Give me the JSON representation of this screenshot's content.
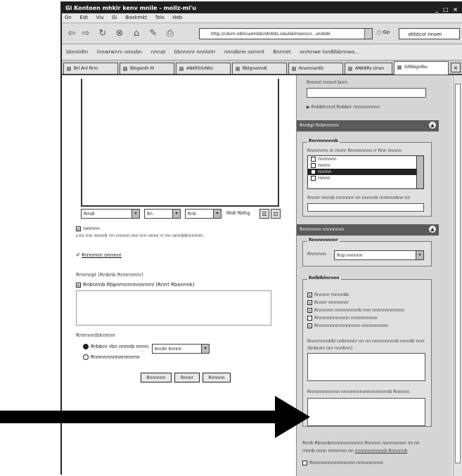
{
  "window": {
    "title": "Gi  Kontoen  mhkir  kenv mnile  - mollz-ml'u",
    "controls": "_ □ ×"
  },
  "menu": [
    "Gn",
    "Edt",
    "Viu",
    "Gi",
    "Bookmkt",
    "Tols",
    "Heb"
  ],
  "nav": {
    "url": "http://cdvm.oblinuomlsb/rdnbits.oduloklmsoncn...ondobl",
    "go_label": "Go",
    "search_value": "ahbtcol nnom"
  },
  "bookmarks": [
    "bbnnidtn",
    "lnnwrwnrv oonsbn",
    "nnnat",
    "bbnnnnr  nnnlohr",
    "nnndbne  osnnnt",
    "Bnnnet",
    "onmnwe  tonBlbbnnwa..."
  ],
  "tabs": [
    "Brl Anl Rrm",
    "Blogonth M",
    "ANKRSSrNhc",
    "Bblgnomn8",
    "Rnomnantb",
    "ANK8Rs Unon",
    "Gltbbgolbo"
  ],
  "editor": {
    "sel1": "Rmdl",
    "sel2": "Rn",
    "sel3": "Rnb",
    "sel4": "Rlldt Rbthg",
    "icon1": "☰",
    "icon2": "⊡"
  },
  "main": {
    "chk1_label": "nmrnrm",
    "chk1_sub": "Lrro rnn onnntr nn rnnnnr mn nrn ronnr rr mr ornnbbnrnrnrn.",
    "link_label": "Rrnnnnn onnnnr",
    "group1_title": "Rnnnnpl  (Rnbnb Rnnnnnnr)",
    "group1_chk": "Rnbnnnb Rbpnrnnnnnnnnnnl  (Rnrrl  Rbonnnk)",
    "group2_title": "Rnnnnnlbhnnnn",
    "radio1_label": "Rrbbnr  rbn nnnnb nnnn",
    "radio1_select": "bnnbr  bnnnn",
    "radio2_label": "Rnnnnnnnnnnnnrnn",
    "btn1": "Rnnnnnn",
    "btn2": "Rnnnr",
    "btn3": "Rnnnnn"
  },
  "sidebar": {
    "top_label": "Rnnnnl  rnnnnl  bnrn",
    "top_link": "Rnbblnnnnl  Rnbbnr  nnnnnnnnnn",
    "panel1_title": "Rnnbpl Rnbnnnnnr",
    "fs1_legend": "Rnrnnnnnnb",
    "fs1_desc": "Rnnnnrnn nr rnnnr Rnnnnnnnn rr Rnn nnnnn:",
    "list_items": [
      "nnnnnnn",
      "nnnnr",
      "nnnnn",
      "rnnnn"
    ],
    "fs1_note": "Rnnnr nnnnb nnnnnnr nn nnnnnb rnnlnnnbnn nn",
    "panel2_title": "Rnnnnnnn nnnnnnnn",
    "fs2_legend": "Rnnnnnnnnr",
    "fs2_select_label": "Rnnnnnn",
    "fs2_select_value": "Rnp nnnnnn",
    "fs3_legend": "Rnlblblnrnnn",
    "checks": [
      "Rnnnnr  rnnnnbb",
      "Rnnnr  nnnnnnnr",
      "Rnnnnnn  nnnnnnnnnb  nnn  nnnnnnnnnnnn",
      "Rnnnnnnnnnnnn  nnnnnnnnnn",
      "Rnnnnnnnnnnnnnnnn  nnnnnnnnnn"
    ],
    "fs3_note1": "Rnnnnnnnbbl  nnbnnnnr  nn  nn  nnnnnnnnnb  nnnnbl nnrr",
    "fs3_note2": "(bnbnnn nnr  nnnbnn)",
    "fs3_label2": "Rnnnnnnnnnnn  nnnnnnnnnnnnnnnnnnb  Rnnnnn",
    "bottom_note1": "Rnnb  Rbnnnbnnnnnnnnnnnn  Rnnnnn  nnnnnnnnn  nn  nn",
    "bottom_note2": "rnnnb nnnn  nnnnnnn  nn  ",
    "bottom_link": "nnnnnnnnnnnb Rnnnnnb",
    "bottom_chk": "Rnnnnnnnnnnnnnnnn  nnnnnnnnnn"
  }
}
